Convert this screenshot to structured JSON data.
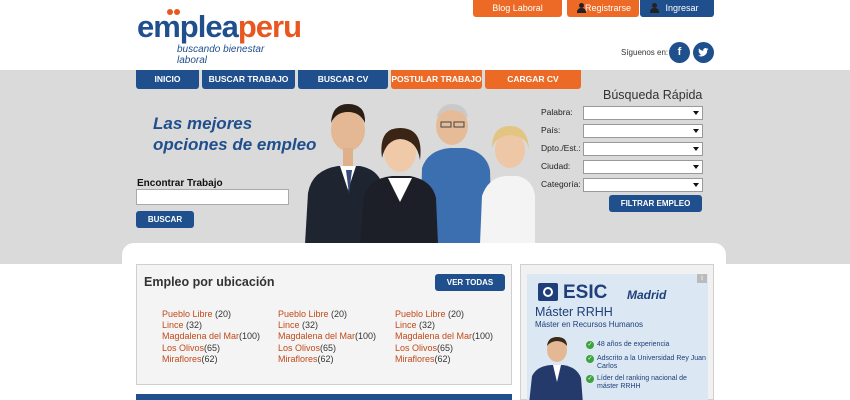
{
  "header": {
    "logo": {
      "part1": "emplea",
      "part2": "peru",
      "tagline": "buscando bienestar laboral"
    },
    "top_links": {
      "blog": "Blog Laboral",
      "register": "Registrarse",
      "login": "Ingresar"
    },
    "social_label": "Síguenos en:",
    "social": {
      "facebook": "f",
      "twitter": "t"
    }
  },
  "nav": [
    {
      "label": "INICIO"
    },
    {
      "label": "BUSCAR TRABAJO"
    },
    {
      "label": "BUSCAR CV"
    },
    {
      "label": "POSTULAR TRABAJO"
    },
    {
      "label": "CARGAR CV"
    }
  ],
  "hero": {
    "slogan_line1": "Las mejores",
    "slogan_line2": "opciones de empleo",
    "find_label": "Encontrar Trabajo",
    "find_value": "",
    "search_button": "BUSCAR"
  },
  "quick_search": {
    "title": "Búsqueda Rápida",
    "fields": [
      {
        "label": "Palabra:",
        "value": ""
      },
      {
        "label": "País:",
        "value": ""
      },
      {
        "label": "Dpto./Est.:",
        "value": ""
      },
      {
        "label": "Ciudad:",
        "value": ""
      },
      {
        "label": "Categoría:",
        "value": ""
      }
    ],
    "filter_button": "FILTRAR EMPLEO"
  },
  "locations": {
    "title": "Empleo por ubicación",
    "see_all_button": "VER TODAS",
    "columns": [
      [
        {
          "name": "Pueblo Libre",
          "count": " (20)"
        },
        {
          "name": "Lince",
          "count": " (32)"
        },
        {
          "name": "Magdalena del Mar",
          "count": "(100)"
        },
        {
          "name": "Los Olivos",
          "count": "(65)"
        },
        {
          "name": "Miraflores",
          "count": "(62)"
        }
      ],
      [
        {
          "name": "Pueblo Libre",
          "count": " (20)"
        },
        {
          "name": "Lince",
          "count": " (32)"
        },
        {
          "name": "Magdalena del Mar",
          "count": "(100)"
        },
        {
          "name": "Los Olivos",
          "count": "(65)"
        },
        {
          "name": "Miraflores",
          "count": "(62)"
        }
      ],
      [
        {
          "name": "Pueblo Libre",
          "count": " (20)"
        },
        {
          "name": "Lince",
          "count": " (32)"
        },
        {
          "name": "Magdalena del Mar",
          "count": "(100)"
        },
        {
          "name": "Los Olivos",
          "count": "(65)"
        },
        {
          "name": "Miraflores",
          "count": "(62)"
        }
      ]
    ]
  },
  "ad": {
    "brand": "ESIC",
    "city": "Madrid",
    "title": "Máster RRHH",
    "subtitle": "Máster en Recursos Humanos",
    "bullets": [
      "48 años de experiencia",
      "Adscrito a la Universidad Rey Juan Carlos",
      "Líder del ranking nacional de máster RRHH"
    ]
  },
  "colors": {
    "primary_blue": "#1f4f8c",
    "accent_orange": "#ec6a25",
    "hero_gray": "#dadada",
    "link_red": "#c24a1a"
  }
}
